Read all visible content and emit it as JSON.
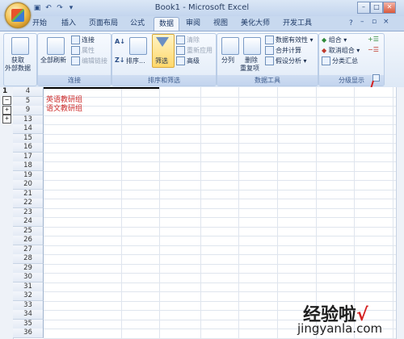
{
  "window": {
    "title": "Book1 - Microsoft Excel",
    "min": "–",
    "max": "□",
    "close": "✕"
  },
  "qat": {
    "save_icon": "save-icon",
    "undo_icon": "undo-icon",
    "redo_icon": "redo-icon"
  },
  "tabs": [
    {
      "label": "开始"
    },
    {
      "label": "插入"
    },
    {
      "label": "页面布局"
    },
    {
      "label": "公式"
    },
    {
      "label": "数据",
      "active": true
    },
    {
      "label": "审阅"
    },
    {
      "label": "视图"
    },
    {
      "label": "美化大师"
    },
    {
      "label": "开发工具"
    }
  ],
  "ribbon": {
    "get_external": {
      "line1": "获取",
      "line2": "外部数据"
    },
    "connections": {
      "label": "连接",
      "refresh_all": "全部刷新",
      "connections": "连接",
      "properties": "属性",
      "edit_links": "编辑链接"
    },
    "sort_filter": {
      "label": "排序和筛选",
      "sort": "排序...",
      "filter": "筛选",
      "clear": "清除",
      "reapply": "重新应用",
      "advanced": "高级"
    },
    "data_tools": {
      "label": "数据工具",
      "text_to_columns": "分列",
      "remove_dup_1": "删除",
      "remove_dup_2": "重复项",
      "validation": "数据有效性",
      "consolidate": "合并计算",
      "what_if": "假设分析"
    },
    "outline": {
      "label": "分级显示",
      "group": "组合",
      "ungroup": "取消组合",
      "subtotal": "分类汇总"
    }
  },
  "outline_levels": {
    "level1": "1",
    "collapse": "−",
    "expand_a": "+",
    "expand_b": "+"
  },
  "rows": [
    "4",
    "5",
    "9",
    "13",
    "14",
    "15",
    "16",
    "17",
    "18",
    "19",
    "20",
    "21",
    "22",
    "23",
    "24",
    "25",
    "26",
    "27",
    "28",
    "29",
    "30",
    "31",
    "32",
    "33",
    "34",
    "35",
    "36"
  ],
  "cells": {
    "row5": "英语教研组",
    "row9": "语文教研组"
  },
  "watermark": {
    "text": "经验啦",
    "check": "√",
    "url": "jingyanla.com"
  }
}
